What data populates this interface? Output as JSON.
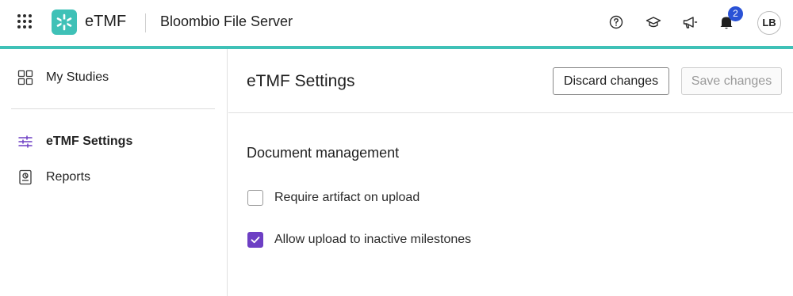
{
  "header": {
    "app_name": "eTMF",
    "server_name": "Bloombio File Server",
    "notification_count": "2",
    "avatar_initials": "LB",
    "icons": [
      "apps-grid-icon",
      "help-icon",
      "graduation-cap-icon",
      "megaphone-icon",
      "bell-icon"
    ]
  },
  "colors": {
    "accent": "#3fc1b7",
    "checkbox_checked": "#6d3fc4",
    "badge": "#2a52d6",
    "active_nav_icon": "#6d3fc4"
  },
  "sidebar": {
    "items": [
      {
        "label": "My Studies",
        "icon": "grid-icon",
        "active": false
      },
      {
        "label": "eTMF Settings",
        "icon": "sliders-icon",
        "active": true
      },
      {
        "label": "Reports",
        "icon": "report-icon",
        "active": false
      }
    ]
  },
  "main": {
    "title": "eTMF Settings",
    "discard_label": "Discard changes",
    "save_label": "Save changes",
    "section_title": "Document management",
    "options": [
      {
        "label": "Require artifact on upload",
        "checked": false
      },
      {
        "label": "Allow upload to inactive milestones",
        "checked": true
      }
    ]
  }
}
